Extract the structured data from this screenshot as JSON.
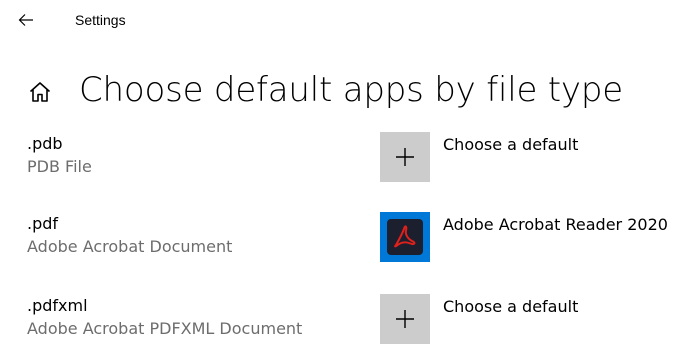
{
  "window": {
    "title": "Settings"
  },
  "header": {
    "title": "Choose default apps by file type"
  },
  "file_types": [
    {
      "extension": ".pdb",
      "description": "PDB File",
      "app": "Choose a default",
      "icon": "plus-icon"
    },
    {
      "extension": ".pdf",
      "description": "Adobe Acrobat Document",
      "app": "Adobe Acrobat Reader 2020",
      "icon": "adobe-acrobat-icon"
    },
    {
      "extension": ".pdfxml",
      "description": "Adobe Acrobat PDFXML Document",
      "app": "Choose a default",
      "icon": "plus-icon"
    }
  ],
  "colors": {
    "accent": "#0078d7",
    "tile_gray": "#cccccc",
    "secondary_text": "#6d6d6d",
    "acrobat_red": "#e0201b"
  }
}
